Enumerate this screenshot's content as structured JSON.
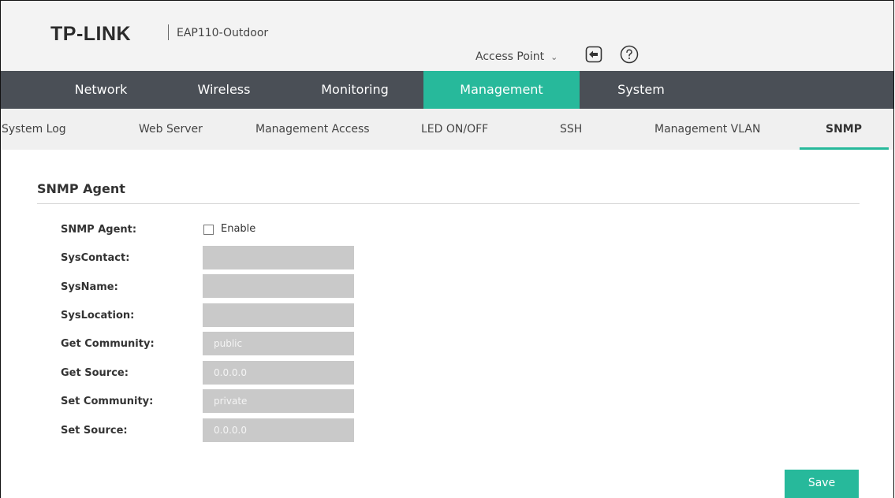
{
  "header": {
    "brand": "TP-LINK",
    "model": "EAP110-Outdoor",
    "mode_label": "Access Point",
    "mode_chevron": "⌄",
    "logout_icon": "logout-icon",
    "help_icon": "help-icon"
  },
  "main_nav": {
    "tabs": [
      {
        "label": "Network"
      },
      {
        "label": "Wireless"
      },
      {
        "label": "Monitoring"
      },
      {
        "label": "Management"
      },
      {
        "label": "System"
      }
    ],
    "active": "Management",
    "active_color": "#27b99b",
    "bar_color": "#4a4f56"
  },
  "sub_nav": {
    "tabs": [
      {
        "label": "System Log"
      },
      {
        "label": "Web Server"
      },
      {
        "label": "Management Access"
      },
      {
        "label": "LED ON/OFF"
      },
      {
        "label": "SSH"
      },
      {
        "label": "Management VLAN"
      },
      {
        "label": "SNMP"
      }
    ],
    "active": "SNMP"
  },
  "section": {
    "title": "SNMP Agent"
  },
  "form": {
    "snmp_agent": {
      "label": "SNMP Agent:",
      "checkbox_label": "Enable",
      "checked": false
    },
    "sys_contact": {
      "label": "SysContact:",
      "value": ""
    },
    "sys_name": {
      "label": "SysName:",
      "value": ""
    },
    "sys_location": {
      "label": "SysLocation:",
      "value": ""
    },
    "get_community": {
      "label": "Get Community:",
      "value": "public"
    },
    "get_source": {
      "label": "Get Source:",
      "value": "0.0.0.0"
    },
    "set_community": {
      "label": "Set Community:",
      "value": "private"
    },
    "set_source": {
      "label": "Set Source:",
      "value": "0.0.0.0"
    }
  },
  "actions": {
    "save_label": "Save"
  }
}
